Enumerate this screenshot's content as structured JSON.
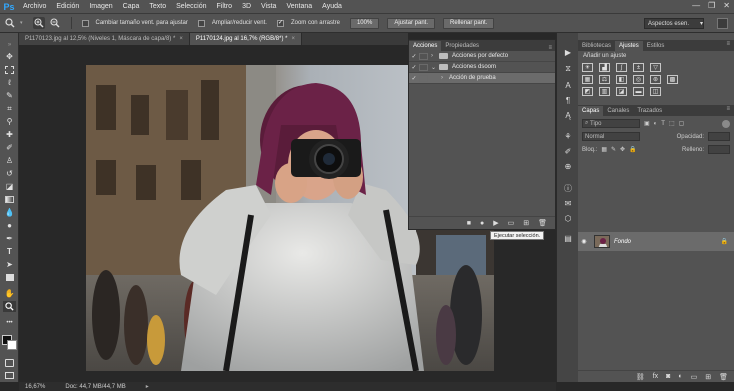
{
  "app": {
    "logo": "Ps"
  },
  "menu": [
    "Archivo",
    "Edición",
    "Imagen",
    "Capa",
    "Texto",
    "Selección",
    "Filtro",
    "3D",
    "Vista",
    "Ventana",
    "Ayuda"
  ],
  "window_controls": {
    "minimize": "—",
    "restore": "❐",
    "close": "✕"
  },
  "options_bar": {
    "resize_windows_label": "Cambiar tamaño vent. para ajustar",
    "resize_windows_checked": false,
    "zoom_windows_label": "Ampliar/reducir vent.",
    "zoom_windows_checked": false,
    "scrubby_zoom_label": "Zoom con arrastre",
    "scrubby_zoom_checked": true,
    "zoom_100_label": "100%",
    "fit_screen_label": "Ajustar pant.",
    "fill_screen_label": "Rellenar pant.",
    "workspace": "Aspectos esen."
  },
  "document_tabs": [
    {
      "label": "P1170123.jpg al 12,5% (Niveles 1, Máscara de capa/8) *",
      "active": false
    },
    {
      "label": "P1170124.jpg al 16,7% (RGB/8*) *",
      "active": true
    }
  ],
  "status": {
    "zoom": "16,67%",
    "doc": "Doc: 44,7 MB/44,7 MB"
  },
  "actions_panel": {
    "tabs": [
      "Acciones",
      "Propiedades"
    ],
    "active_tab": "Acciones",
    "rows": [
      {
        "label": "Acciones por defecto",
        "type": "set",
        "checked": true,
        "expanded": false
      },
      {
        "label": "Acciones dsoom",
        "type": "set",
        "checked": true,
        "expanded": true
      },
      {
        "label": "Acción de prueba",
        "type": "action",
        "checked": true,
        "selected": true
      }
    ],
    "tooltip": "Ejecutar selección."
  },
  "adjustments_panel": {
    "tabs": [
      "Bibliotecas",
      "Ajustes",
      "Estilos"
    ],
    "active_tab": "Ajustes",
    "hint": "Añadir un ajuste"
  },
  "layers_panel": {
    "tabs": [
      "Capas",
      "Canales",
      "Trazados"
    ],
    "active_tab": "Capas",
    "filter_kind": "Tipo",
    "blend_mode": "Normal",
    "opacity_label": "Opacidad:",
    "lock_label": "Bloq.:",
    "fill_label": "Relleno:",
    "layers": [
      {
        "name": "Fondo",
        "visible": true,
        "locked": true
      }
    ]
  },
  "colors": {
    "panel": "#535353",
    "dark": "#282828",
    "accent": "#31a8ff"
  }
}
